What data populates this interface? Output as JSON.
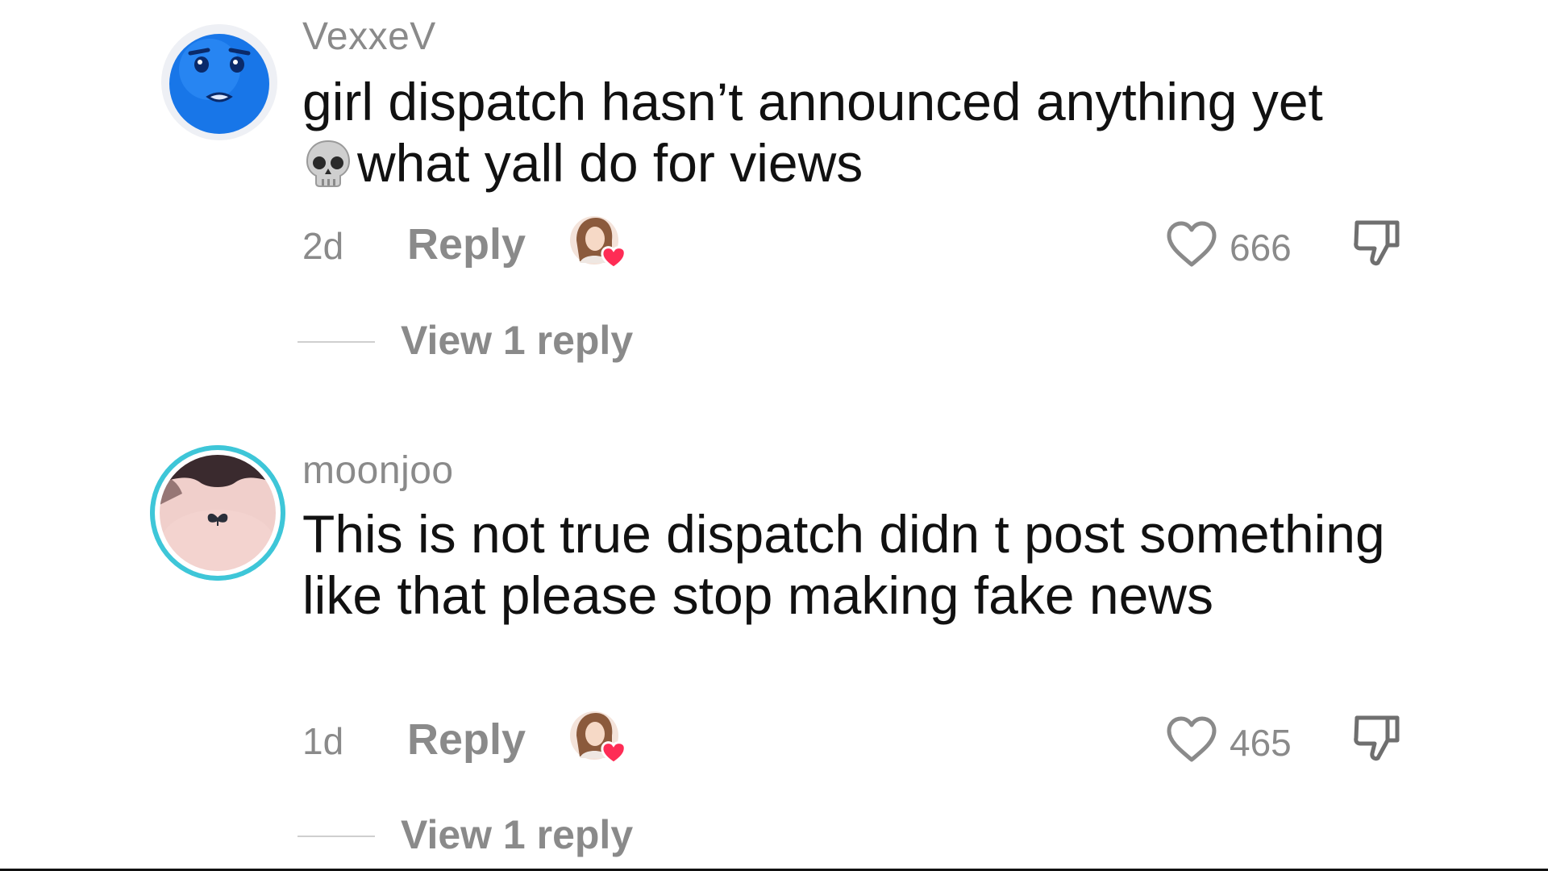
{
  "comments": [
    {
      "username": "VexxeV",
      "text_line1": "girl dispatch hasn’t announced anything yet",
      "text_line2": "what yall do for views",
      "emoji_icon": "skull-icon",
      "age": "2d",
      "reply_label": "Reply",
      "likes": "666",
      "view_replies_label": "View 1 reply",
      "avatar_icon": "blue-emoji-avatar"
    },
    {
      "username": "moonjoo",
      "text": "This is not true dispatch didn t post something like that please stop making fake news",
      "age": "1d",
      "reply_label": "Reply",
      "likes": "465",
      "view_replies_label": "View 1 reply",
      "avatar_icon": "butterfly-tattoo-avatar",
      "avatar_ring_color": "#3ec6d8"
    }
  ],
  "colors": {
    "text_primary": "#111111",
    "text_secondary": "#8a8a8a",
    "creator_heart": "#fe2c55",
    "background": "#ffffff"
  },
  "icons": {
    "like": "heart-outline-icon",
    "dislike": "thumbs-down-icon",
    "creator_liked": "creator-liked-badge"
  }
}
